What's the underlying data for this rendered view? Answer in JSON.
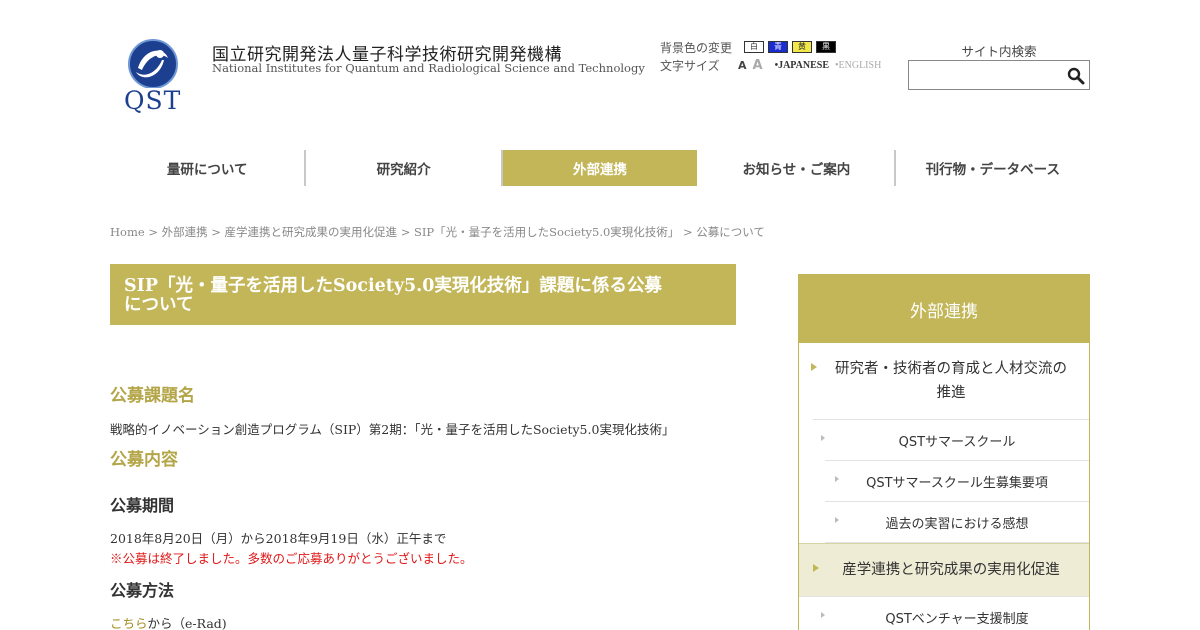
{
  "header": {
    "logo_text": "QST",
    "org_name_jp": "国立研究開発法人量子科学技術研究開発機構",
    "org_name_en": "National Institutes for Quantum and Radiological Science and Technology",
    "bg_color_label": "背景色の変更",
    "bg_options": [
      "白",
      "青",
      "黄",
      "黒"
    ],
    "font_size_label": "文字サイズ",
    "font_size_options": [
      "A",
      "A"
    ],
    "lang_jp": "•JAPANESE",
    "lang_en": "•ENGLISH",
    "search_label": "サイト内検索",
    "search_value": ""
  },
  "nav": {
    "items": [
      "量研について",
      "研究紹介",
      "外部連携",
      "お知らせ・ご案内",
      "刊行物・データベース"
    ],
    "active_index": 2
  },
  "breadcrumb": "Home > 外部連携 > 産学連携と研究成果の実用化促進 > SIP「光・量子を活用したSociety5.0実現化技術」 > 公募について",
  "main": {
    "title_line1": "SIP「光・量子を活用したSociety5.0実現化技術」課題に係る公募",
    "title_line2": "について",
    "sec1_heading": "公募課題名",
    "sec1_text": "戦略的イノベーション創造プログラム（SIP）第2期：「光・量子を活用したSociety5.0実現化技術」",
    "sec2_heading": "公募内容",
    "period_heading": "公募期間",
    "period_text": "2018年8月20日（月）から2018年9月19日（水）正午まで",
    "period_notice": "※公募は終了しました。多数のご応募ありがとうございました。",
    "method_heading": "公募方法",
    "method_link": "こちら",
    "method_text": "から（e-Rad)"
  },
  "sidebar": {
    "heading": "外部連携",
    "item1_line1": "研究者・技術者の育成と人材交流の",
    "item1_line2": "推進",
    "sub1": "QSTサマースクール",
    "sub1a": "QSTサマースクール生募集要項",
    "sub1b": "過去の実習における感想",
    "item2": "産学連携と研究成果の実用化促進",
    "sub2": "QSTベンチャー支援制度"
  },
  "colors": {
    "accent": "#c2b659",
    "heading_gold": "#b4a648",
    "notice_red": "#e01818",
    "brand_blue": "#1d3f8f"
  }
}
